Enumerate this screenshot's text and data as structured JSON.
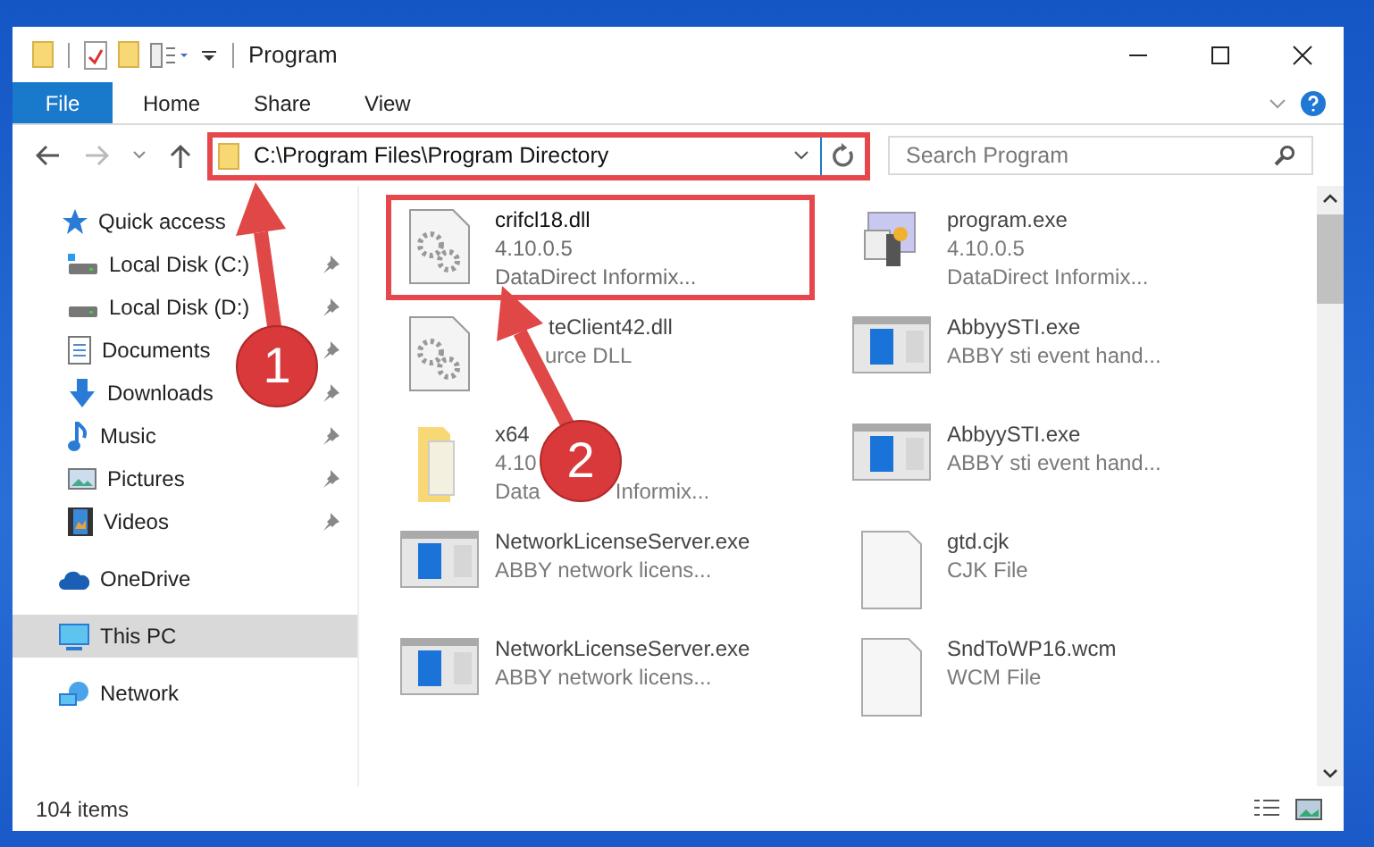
{
  "window": {
    "title": "Program"
  },
  "ribbon_tabs": [
    {
      "label": "File",
      "kind": "file"
    },
    {
      "label": "Home",
      "kind": "tab"
    },
    {
      "label": "Share",
      "kind": "tab"
    },
    {
      "label": "View",
      "kind": "tab"
    }
  ],
  "address_bar": {
    "path": "C:\\Program Files\\Program Directory",
    "highlighted": true
  },
  "search": {
    "placeholder": "Search Program"
  },
  "sidebar": {
    "items": [
      {
        "label": "Quick access",
        "selected": false,
        "children": [
          {
            "label": "Local Disk (C:)",
            "pinned": true,
            "selected": false
          },
          {
            "label": "Local Disk (D:)",
            "pinned": true,
            "selected": false
          },
          {
            "label": "Documents",
            "pinned": true,
            "selected": false
          },
          {
            "label": "Downloads",
            "pinned": true,
            "selected": false
          },
          {
            "label": "Music",
            "pinned": true,
            "selected": false
          },
          {
            "label": "Pictures",
            "pinned": true,
            "selected": false
          },
          {
            "label": "Videos",
            "pinned": true,
            "selected": false
          }
        ]
      },
      {
        "label": "OneDrive",
        "selected": false
      },
      {
        "label": "This PC",
        "selected": true
      },
      {
        "label": "Network",
        "selected": false
      }
    ]
  },
  "files": [
    {
      "name": "crifcl18.dll",
      "details": [
        [
          "4.10.0.5"
        ],
        [
          "DataDirect Informix..."
        ]
      ],
      "kind": "dll",
      "highlighted": true,
      "faded": false
    },
    {
      "name": "program.exe",
      "details": [
        [
          "4.10.0.5"
        ],
        [
          "DataDirect Informix..."
        ]
      ],
      "kind": "app",
      "highlighted": false,
      "faded": true
    },
    {
      "name": "teClient42.dll",
      "details": [
        [
          "urce DLL"
        ]
      ],
      "kind": "dll",
      "highlighted": false,
      "faded": true
    },
    {
      "name": "AbbyySTI.exe",
      "details": [
        [
          "ABBY sti event hand..."
        ]
      ],
      "kind": "window",
      "highlighted": false,
      "faded": true
    },
    {
      "name": "x64",
      "details": [
        [
          "4.10"
        ],
        [
          "Data",
          "Informix..."
        ]
      ],
      "kind": "folder",
      "highlighted": false,
      "faded": true
    },
    {
      "name": "AbbyySTI.exe",
      "details": [
        [
          "ABBY sti event hand..."
        ]
      ],
      "kind": "window",
      "highlighted": false,
      "faded": true
    },
    {
      "name": "NetworkLicenseServer.exe",
      "details": [
        [
          "ABBY network licens..."
        ]
      ],
      "kind": "window",
      "highlighted": false,
      "faded": true
    },
    {
      "name": "gtd.cjk",
      "details": [
        [
          "CJK File"
        ]
      ],
      "kind": "blank",
      "highlighted": false,
      "faded": true
    },
    {
      "name": "NetworkLicenseServer.exe",
      "details": [
        [
          "ABBY network licens..."
        ]
      ],
      "kind": "window",
      "highlighted": false,
      "faded": true
    },
    {
      "name": "SndToWP16.wcm",
      "details": [
        [
          "WCM File"
        ]
      ],
      "kind": "blank",
      "highlighted": false,
      "faded": true
    }
  ],
  "status_bar": {
    "item_count": "104 items"
  },
  "annotations": [
    {
      "number": "1"
    },
    {
      "number": "2"
    }
  ]
}
